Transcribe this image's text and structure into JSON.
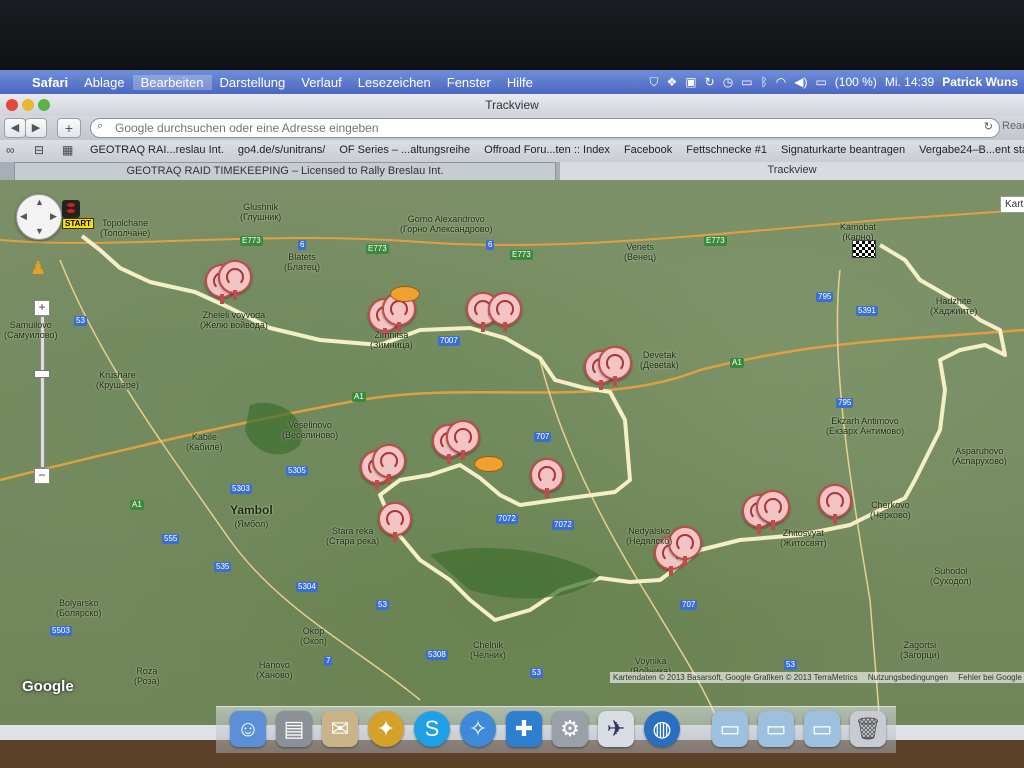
{
  "menubar": {
    "app": "Safari",
    "items": [
      "Ablage",
      "Bearbeiten",
      "Darstellung",
      "Verlauf",
      "Lesezeichen",
      "Fenster",
      "Hilfe"
    ],
    "battery": "(100 %)",
    "clock": "Mi. 14:39",
    "user": "Patrick Wuns"
  },
  "window": {
    "title": "Trackview"
  },
  "toolbar": {
    "back_icon": "◀",
    "forward_icon": "▶",
    "add_label": "+",
    "address_placeholder": "Google durchsuchen oder eine Adresse eingeben",
    "reader_label": "Read"
  },
  "bookmarks": [
    "GEOTRAQ RAI...reslau Int.",
    "go4.de/s/unitrans/",
    "OF Series – ...altungsreihe",
    "Offroad Foru...ten :: Index",
    "Facebook",
    "Fettschnecke #1",
    "Signaturkarte beantragen",
    "Vergabe24–B...ent starten"
  ],
  "tabs": [
    {
      "label": "GEOTRAQ RAID TIMEKEEPING – Licensed to Rally Breslau Int."
    },
    {
      "label": "Trackview"
    }
  ],
  "map": {
    "maptype_label": "Kart",
    "start_label": "START",
    "google_logo": "Google",
    "copyright": [
      "Kartendaten © 2013 Basarsoft, Google Grafiken © 2013 TerraMetrics",
      "Nutzungsbedingungen",
      "Fehler bei Google Maps"
    ],
    "towns": [
      {
        "name": "Topolchane",
        "cyr": "(Тополчане)"
      },
      {
        "name": "Glushnik",
        "cyr": "(Глушник)"
      },
      {
        "name": "Gorno Alexandrovo",
        "cyr": "(Горно Александрово)"
      },
      {
        "name": "Blatets",
        "cyr": "(Блатец)"
      },
      {
        "name": "Venets",
        "cyr": "(Венец)"
      },
      {
        "name": "Kamobat",
        "cyr": "(Карно)"
      },
      {
        "name": "Zheleli voyvoda",
        "cyr": "(Желю войвода)"
      },
      {
        "name": "Zimnitsa",
        "cyr": "(Зимница)"
      },
      {
        "name": "Devetak",
        "cyr": "(Девеtak)"
      },
      {
        "name": "Samuilovo",
        "cyr": "(Самуилово)"
      },
      {
        "name": "Krushare",
        "cyr": "(Крушаре)"
      },
      {
        "name": "Veselinovo",
        "cyr": "(Веселиново)"
      },
      {
        "name": "Kabile",
        "cyr": "(Кабиле)"
      },
      {
        "name": "Yambol",
        "cyr": "(Ямбол)"
      },
      {
        "name": "Stara reka",
        "cyr": "(Стара река)"
      },
      {
        "name": "Nedyalsko",
        "cyr": "(Недялско)"
      },
      {
        "name": "Ekzarh Antimovo",
        "cyr": "(Екзарх Антимово)"
      },
      {
        "name": "Hadzhite",
        "cyr": "(Хаджиите)"
      },
      {
        "name": "Asparuhovo",
        "cyr": "(Аспарухово)"
      },
      {
        "name": "Bolyarsko",
        "cyr": "(Болярско)"
      },
      {
        "name": "Okop",
        "cyr": "(Окоп)"
      },
      {
        "name": "Hanovo",
        "cyr": "(Ханово)"
      },
      {
        "name": "Roza",
        "cyr": "(Роза)"
      },
      {
        "name": "Chelnik",
        "cyr": "(Челник)"
      },
      {
        "name": "Voynika",
        "cyr": "(Войника)"
      },
      {
        "name": "Suhodol",
        "cyr": "(Суходол)"
      },
      {
        "name": "Zagortsi",
        "cyr": "(Загорци)"
      },
      {
        "name": "Zhitosvyat",
        "cyr": "(Житосвят)"
      },
      {
        "name": "Cherkovo",
        "cyr": "(Черково)"
      }
    ],
    "road_labels": [
      "E773",
      "E773",
      "E773",
      "E773",
      "A1",
      "A1",
      "A1",
      "6",
      "6",
      "53",
      "53",
      "7007",
      "707",
      "7072",
      "7072",
      "5305",
      "5303",
      "535",
      "555",
      "5304",
      "5308",
      "5503",
      "795",
      "795",
      "5391",
      "707",
      "7",
      "53",
      "53"
    ]
  },
  "dock": {
    "icons": [
      "finder-icon",
      "preview-icon",
      "mail-icon",
      "compass-app-icon",
      "skype-icon",
      "safari-icon",
      "puzzle-icon",
      "preferences-icon",
      "mail-drive-icon",
      "globe-icon",
      "folder-icon",
      "folder-icon",
      "folder-icon",
      "trash-icon"
    ]
  },
  "colors": {
    "menubar": "#4b67c2",
    "route": "#f4efc4",
    "marker": "#c04b4b"
  }
}
